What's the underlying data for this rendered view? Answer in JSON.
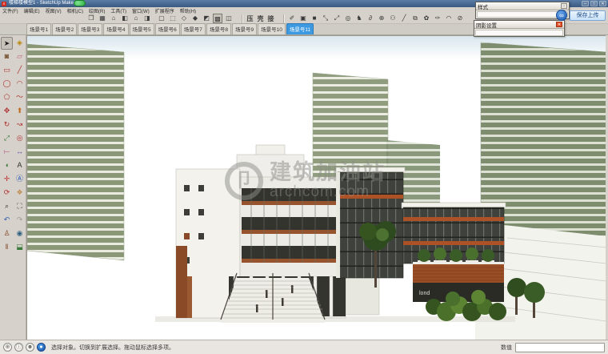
{
  "window": {
    "title": "楼梯楼模型1 - SketchUp Make",
    "logo_glyph": "S",
    "controls": {
      "minimize": "─",
      "maximize": "□",
      "close": "✕"
    }
  },
  "menubar": {
    "items": [
      "文件(F)",
      "编辑(E)",
      "视图(V)",
      "相机(C)",
      "绘图(R)",
      "工具(T)",
      "窗口(W)",
      "扩展程序",
      "帮助(H)"
    ]
  },
  "toolbar": {
    "view_icons": [
      {
        "name": "iso-view-icon",
        "glyph": "❐"
      },
      {
        "name": "top-view-icon",
        "glyph": "▦"
      },
      {
        "name": "front-view-icon",
        "glyph": "⌂"
      },
      {
        "name": "right-view-icon",
        "glyph": "◧"
      },
      {
        "name": "back-view-icon",
        "glyph": "⌂"
      },
      {
        "name": "left-view-icon",
        "glyph": "◨"
      }
    ],
    "face_style_icons": [
      {
        "name": "xray-style-icon",
        "glyph": "▢"
      },
      {
        "name": "back-edges-style-icon",
        "glyph": "⬚"
      },
      {
        "name": "wireframe-style-icon",
        "glyph": "◇"
      },
      {
        "name": "hidden-line-style-icon",
        "glyph": "◆"
      },
      {
        "name": "shaded-style-icon",
        "glyph": "◩"
      },
      {
        "name": "shaded-textures-style-icon",
        "glyph": "▩"
      },
      {
        "name": "monochrome-style-icon",
        "glyph": "◫"
      }
    ],
    "face_styles_active_index": 5,
    "text_buttons": [
      "压",
      "壳",
      "接"
    ],
    "plugin_icons": [
      {
        "name": "plugin-pencil-icon",
        "glyph": "✐"
      },
      {
        "name": "plugin-panel-icon",
        "glyph": "▣"
      },
      {
        "name": "plugin-fill-icon",
        "glyph": "■"
      },
      {
        "name": "plugin-scale-x-icon",
        "glyph": "⤡"
      },
      {
        "name": "plugin-scale-y-icon",
        "glyph": "⤢"
      },
      {
        "name": "plugin-target-icon",
        "glyph": "◎"
      },
      {
        "name": "plugin-knight-icon",
        "glyph": "♞"
      },
      {
        "name": "plugin-curve-icon",
        "glyph": "∂"
      },
      {
        "name": "plugin-gear-icon",
        "glyph": "⊕"
      },
      {
        "name": "plugin-node-icon",
        "glyph": "⚇"
      },
      {
        "name": "plugin-line-icon",
        "glyph": "╱"
      },
      {
        "name": "plugin-grid-icon",
        "glyph": "⧉"
      },
      {
        "name": "plugin-flower-icon",
        "glyph": "✿"
      },
      {
        "name": "plugin-pen-icon",
        "glyph": "✑"
      },
      {
        "name": "plugin-arc-icon",
        "glyph": "◠"
      },
      {
        "name": "plugin-slash-icon",
        "glyph": "⊘"
      }
    ]
  },
  "scene_tabs": {
    "tabs": [
      "场景号1",
      "场景号2",
      "场景号3",
      "场景号4",
      "场景号5",
      "场景号6",
      "场景号7",
      "场景号8",
      "场景号9",
      "场景号10",
      "场景号11"
    ],
    "active_index": 10
  },
  "tool_palette": {
    "active_index": 0,
    "tools": [
      {
        "name": "select-tool-icon",
        "glyph": "➤",
        "color": "#1a1a1a"
      },
      {
        "name": "make-component-tool-icon",
        "glyph": "◈",
        "color": "#b8860b"
      },
      {
        "name": "paint-bucket-tool-icon",
        "glyph": "◙",
        "color": "#7a5230"
      },
      {
        "name": "eraser-tool-icon",
        "glyph": "▱",
        "color": "#c06080"
      },
      {
        "name": "rectangle-tool-icon",
        "glyph": "▭",
        "color": "#b03030"
      },
      {
        "name": "line-tool-icon",
        "glyph": "╱",
        "color": "#b03030"
      },
      {
        "name": "circle-tool-icon",
        "glyph": "◯",
        "color": "#b03030"
      },
      {
        "name": "arc-tool-icon",
        "glyph": "◠",
        "color": "#b03030"
      },
      {
        "name": "polygon-tool-icon",
        "glyph": "⬠",
        "color": "#b03030"
      },
      {
        "name": "freehand-tool-icon",
        "glyph": "〜",
        "color": "#b03030"
      },
      {
        "name": "move-tool-icon",
        "glyph": "✥",
        "color": "#b03030"
      },
      {
        "name": "push-pull-tool-icon",
        "glyph": "⬆",
        "color": "#c06a20"
      },
      {
        "name": "rotate-tool-icon",
        "glyph": "↻",
        "color": "#b03030"
      },
      {
        "name": "follow-me-tool-icon",
        "glyph": "↝",
        "color": "#b03030"
      },
      {
        "name": "scale-tool-icon",
        "glyph": "⤢",
        "color": "#3a7a3a"
      },
      {
        "name": "offset-tool-icon",
        "glyph": "◎",
        "color": "#b03030"
      },
      {
        "name": "tape-measure-tool-icon",
        "glyph": "⟝",
        "color": "#b05080"
      },
      {
        "name": "dimension-tool-icon",
        "glyph": "↔",
        "color": "#6040a0"
      },
      {
        "name": "protractor-tool-icon",
        "glyph": "◖",
        "color": "#3a7a3a"
      },
      {
        "name": "text-tool-icon",
        "glyph": "A",
        "color": "#303030"
      },
      {
        "name": "axes-tool-icon",
        "glyph": "✛",
        "color": "#c03030"
      },
      {
        "name": "3d-text-tool-icon",
        "glyph": "Ⓐ",
        "color": "#2050b0"
      },
      {
        "name": "orbit-tool-icon",
        "glyph": "⟳",
        "color": "#b03030"
      },
      {
        "name": "pan-tool-icon",
        "glyph": "❖",
        "color": "#c08a50"
      },
      {
        "name": "zoom-tool-icon",
        "glyph": "⌕",
        "color": "#303030"
      },
      {
        "name": "zoom-extents-tool-icon",
        "glyph": "⛶",
        "color": "#303030"
      },
      {
        "name": "previous-view-tool-icon",
        "glyph": "↶",
        "color": "#3060b0"
      },
      {
        "name": "next-view-tool-icon",
        "glyph": "↷",
        "color": "#9a9a9a"
      },
      {
        "name": "position-camera-tool-icon",
        "glyph": "♙",
        "color": "#804020"
      },
      {
        "name": "look-around-tool-icon",
        "glyph": "◉",
        "color": "#306080"
      },
      {
        "name": "walk-tool-icon",
        "glyph": "‖",
        "color": "#804020"
      },
      {
        "name": "section-plane-tool-icon",
        "glyph": "⬓",
        "color": "#3a7a3a"
      }
    ]
  },
  "panels": {
    "styles": {
      "title": "样式",
      "collapse_glyph": "▫"
    },
    "shadow": {
      "title": "阴影设置",
      "close_glyph": "✕"
    }
  },
  "upload": {
    "logo_glyph": "∞",
    "button_label": "保存上传"
  },
  "watermark": {
    "ring_glyph": "卩",
    "text": "建筑加油站",
    "url": "archcom.com"
  },
  "viewport": {
    "signage": "lond"
  },
  "statusbar": {
    "geo_glyph": "⊕",
    "credits_glyph": "ⓘ",
    "user_glyph": "☻",
    "stats_glyph": "●",
    "hint": "选择对象。切换到扩展选择。拖动鼠标选择多项。",
    "measure_label": "数值",
    "measure_value": ""
  },
  "colors": {
    "titlebar": "#3a5a82",
    "chrome": "#d6d2cb",
    "active_tab": "#3d9ae1",
    "tower_green": "#8a9878",
    "accent_orange": "#ad5226",
    "wood": "#9a4e25",
    "glass": "#3f423c",
    "tree_green": "#3a5c26"
  }
}
